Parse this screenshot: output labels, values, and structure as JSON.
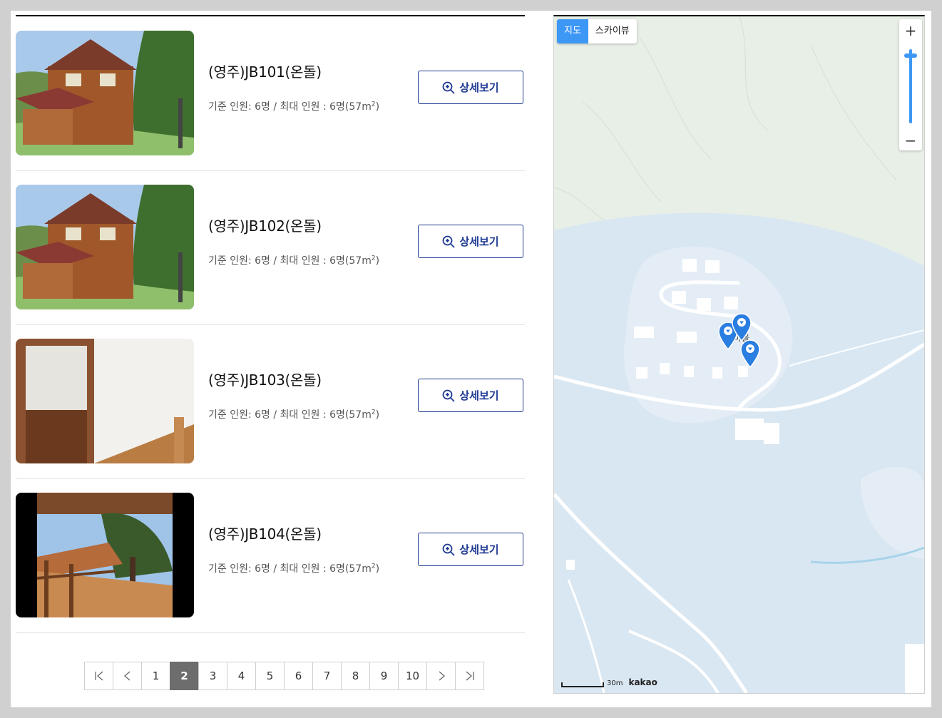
{
  "rooms": [
    {
      "name": "(영주)JB101(온돌)",
      "capacity": "기준 인원: 6명 / 최대 인원 : 6명(57m",
      "unit_sup": "2",
      "capacity_end": ")",
      "button": "상세보기",
      "photo": "house-exterior"
    },
    {
      "name": "(영주)JB102(온돌)",
      "capacity": "기준 인원: 6명 / 최대 인원 : 6명(57m",
      "unit_sup": "2",
      "capacity_end": ")",
      "button": "상세보기",
      "photo": "house-exterior"
    },
    {
      "name": "(영주)JB103(온돌)",
      "capacity": "기준 인원: 6명 / 최대 인원 : 6명(57m",
      "unit_sup": "2",
      "capacity_end": ")",
      "button": "상세보기",
      "photo": "room-interior"
    },
    {
      "name": "(영주)JB104(온돌)",
      "capacity": "기준 인원: 6명 / 최대 인원 : 6명(57m",
      "unit_sup": "2",
      "capacity_end": ")",
      "button": "상세보기",
      "photo": "balcony-view"
    }
  ],
  "pagination": {
    "pages": [
      "1",
      "2",
      "3",
      "4",
      "5",
      "6",
      "7",
      "8",
      "9",
      "10"
    ],
    "current": "2",
    "icons": {
      "first": "first-page-icon",
      "prev": "prev-page-icon",
      "next": "next-page-icon",
      "last": "last-page-icon"
    }
  },
  "map": {
    "types": [
      "지도",
      "스카이뷰"
    ],
    "active_type": "지도",
    "zoom_in": "+",
    "zoom_out": "−",
    "scale": "30m",
    "provider": "kakao",
    "place_label": "마을",
    "colors": {
      "land": "#e8efe6",
      "residential": "#d9e7f2",
      "road": "#ffffff",
      "marker": "#2a7de1",
      "water": "#a7d3ea"
    }
  }
}
